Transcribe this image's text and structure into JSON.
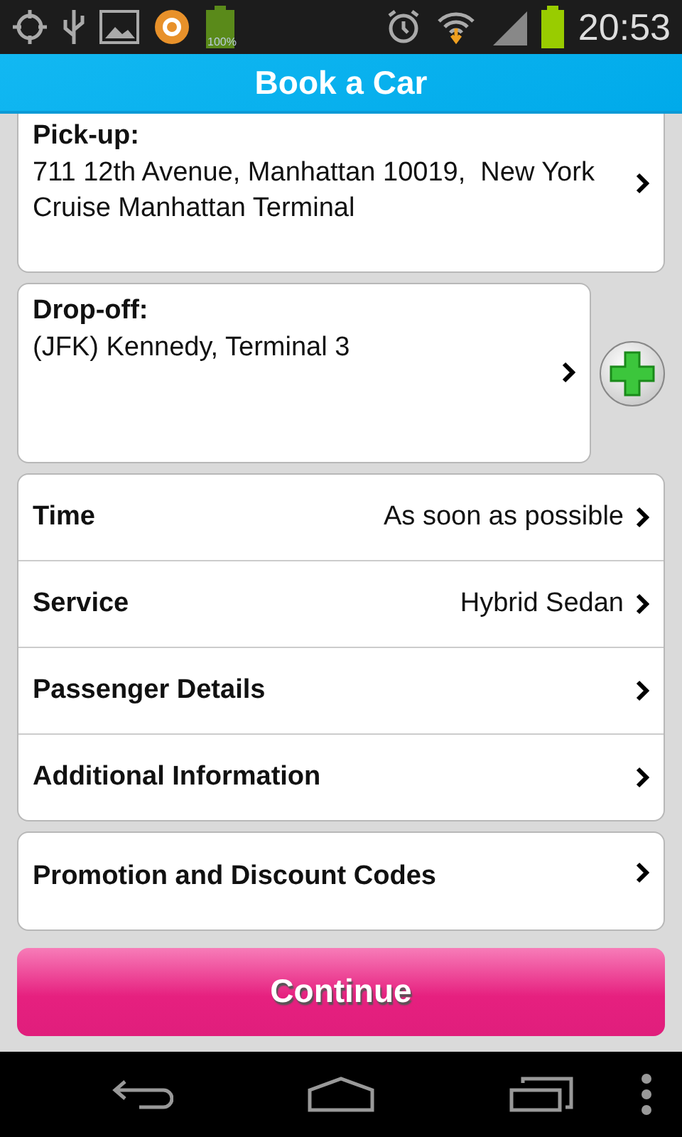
{
  "status_bar": {
    "battery_label": "100%",
    "time": "20:53"
  },
  "header": {
    "title": "Book a Car"
  },
  "pickup": {
    "label": "Pick-up:",
    "address": "711 12th Avenue, Manhattan 10019,  New York Cruise Manhattan Terminal"
  },
  "dropoff": {
    "label": "Drop-off:",
    "address": "(JFK) Kennedy, Terminal 3"
  },
  "options": [
    {
      "label": "Time",
      "value": "As soon as possible"
    },
    {
      "label": "Service",
      "value": "Hybrid Sedan"
    },
    {
      "label": "Passenger Details"
    },
    {
      "label": "Additional Information"
    }
  ],
  "promo": {
    "label": "Promotion and Discount Codes"
  },
  "continue_button": {
    "label": "Continue"
  }
}
